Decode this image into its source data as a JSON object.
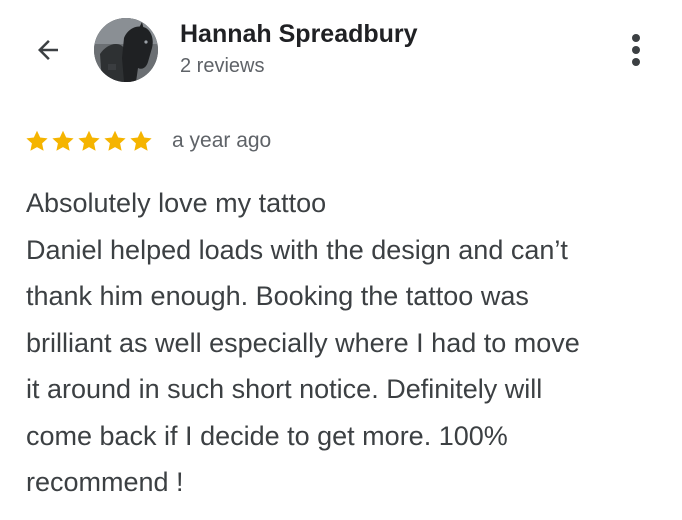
{
  "header": {
    "back_icon": "arrow-left-icon",
    "reviewer_name": "Hannah Spreadbury",
    "review_count": "2 reviews",
    "more_icon": "more-vertical-icon"
  },
  "review": {
    "rating": 5,
    "max_rating": 5,
    "star_color": "#f5b400",
    "time_ago": "a year ago",
    "lines": [
      "Absolutely love my tattoo",
      "Daniel helped loads with the design and can’t",
      "thank him enough. Booking the tattoo was",
      "brilliant as well especially where I had to move",
      "it around in such short notice. Definitely will",
      "come back if I decide to get more. 100%",
      "recommend !"
    ]
  }
}
